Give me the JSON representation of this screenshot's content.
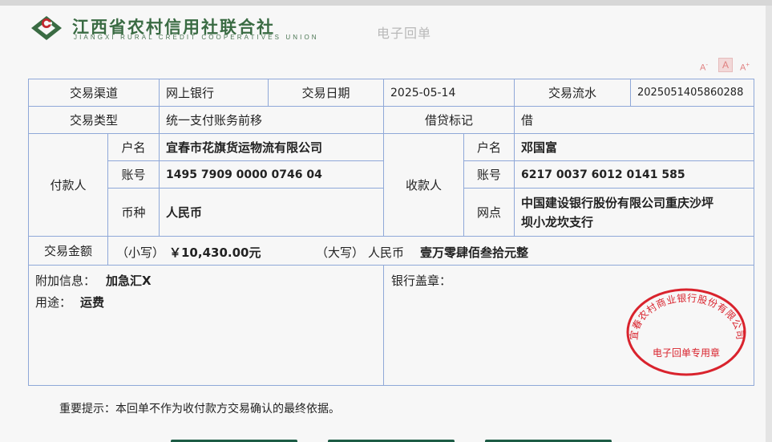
{
  "header": {
    "bank_name": "江西省农村信用社联合社",
    "bank_name_en": "JIANGXI RURAL CREDIT COOPERATIVES UNION",
    "receipt_title": "电子回单"
  },
  "font_tools": {
    "decrease": "A",
    "reset": "A",
    "increase": "A",
    "minus": "-",
    "plus": "+"
  },
  "receipt": {
    "channel_label": "交易渠道",
    "channel": "网上银行",
    "date_label": "交易日期",
    "date": "2025-05-14",
    "serial_label": "交易流水",
    "serial": "2025051405860288",
    "type_label": "交易类型",
    "type": "统一支付账务前移",
    "dc_label": "借贷标记",
    "dc": "借",
    "payer_label": "付款人",
    "payer_name_label": "户名",
    "payer_name": "宜春市花旗货运物流有限公司",
    "payer_acct_label": "账号",
    "payer_acct": "1495 7909 0000 0746 04",
    "payer_currency_label": "币种",
    "payer_currency": "人民币",
    "payee_label": "收款人",
    "payee_name_label": "户名",
    "payee_name": "邓国富",
    "payee_acct_label": "账号",
    "payee_acct": "6217 0037 6012 0141 585",
    "payee_branch_label": "网点",
    "payee_branch_line1": "中国建设银行股份有限公司重庆沙坪",
    "payee_branch_line2": "坝小龙坎支行",
    "amount_label": "交易金额",
    "amount_small_label": "（小写）",
    "amount_small": "￥10,430.00元",
    "amount_big_label": "（大写）",
    "amount_big_currency": "人民币",
    "amount_big": "壹万零肆佰叁拾元整",
    "extra_label": "附加信息：",
    "extra": "加急汇X",
    "purpose_label": "用途：",
    "purpose": "运费",
    "seal_label": "银行盖章："
  },
  "stamp": {
    "arc_text": "宜春农村商业银行股份有限公司",
    "inner_text": "电子回单专用章",
    "color": "#d9232d"
  },
  "notice": "重要提示：本回单不作为收付款方交易确认的最终依据。",
  "colors": {
    "border": "#8fa8d8",
    "brand_green": "#3a6b43",
    "button": "#1d5c45"
  }
}
